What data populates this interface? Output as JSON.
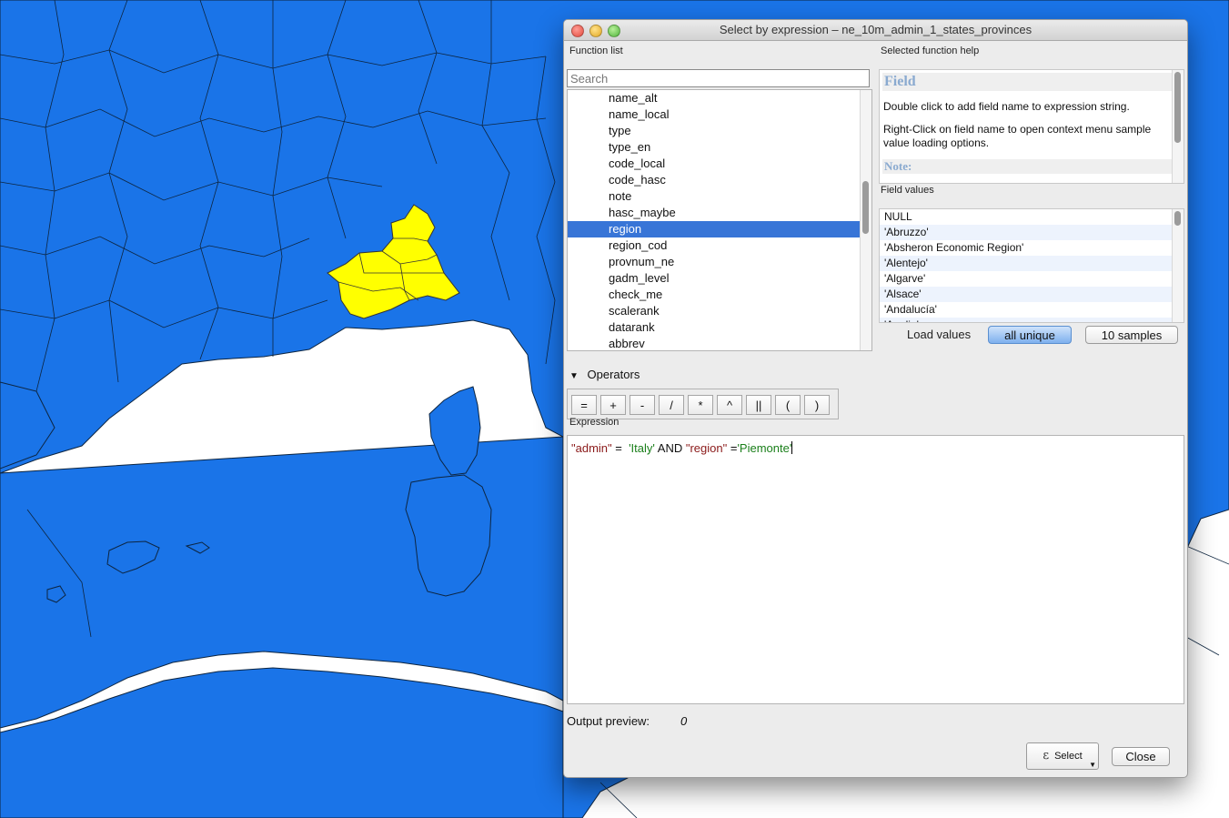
{
  "map": {
    "colors": {
      "background": "#ffffff",
      "land": "#1a74e8",
      "selected": "#ffff00",
      "borders": "#0d2540"
    }
  },
  "dialog": {
    "title": "Select by expression – ne_10m_admin_1_states_provinces",
    "function_list_label": "Function list",
    "search_placeholder": "Search",
    "function_items": [
      "name_alt",
      "name_local",
      "type",
      "type_en",
      "code_local",
      "code_hasc",
      "note",
      "hasc_maybe",
      "region",
      "region_cod",
      "provnum_ne",
      "gadm_level",
      "check_me",
      "scalerank",
      "datarank",
      "abbrev"
    ],
    "selected_item": "region",
    "help_label": "Selected function help",
    "help": {
      "heading": "Field",
      "text1": "Double click to add field name to expression string.",
      "text2": "Right-Click on field name to open context menu sample value loading options.",
      "note": "Note:"
    },
    "field_values_label": "Field values",
    "field_values": [
      "NULL",
      "'Abruzzo'",
      "'Absheron Economic Region'",
      "'Alentejo'",
      "'Algarve'",
      "'Alsace'",
      "'Andalucía'",
      "'Apulia'"
    ],
    "load_values_label": "Load values",
    "all_unique_label": "all unique",
    "samples_label": "10 samples",
    "operators_label": "Operators",
    "operators": [
      "=",
      "+",
      "-",
      "/",
      "*",
      "^",
      "||",
      "(",
      ")"
    ],
    "expression_label": "Expression",
    "expression": {
      "field1": "\"admin\"",
      "op1": " =  ",
      "val1": "'Italy'",
      "kw": " AND ",
      "field2": "\"region\"",
      "op2": " =",
      "val2": "'Piemonte'"
    },
    "output_preview_label": "Output preview:",
    "output_preview_value": "0",
    "select_label": "Select",
    "close_label": "Close"
  }
}
